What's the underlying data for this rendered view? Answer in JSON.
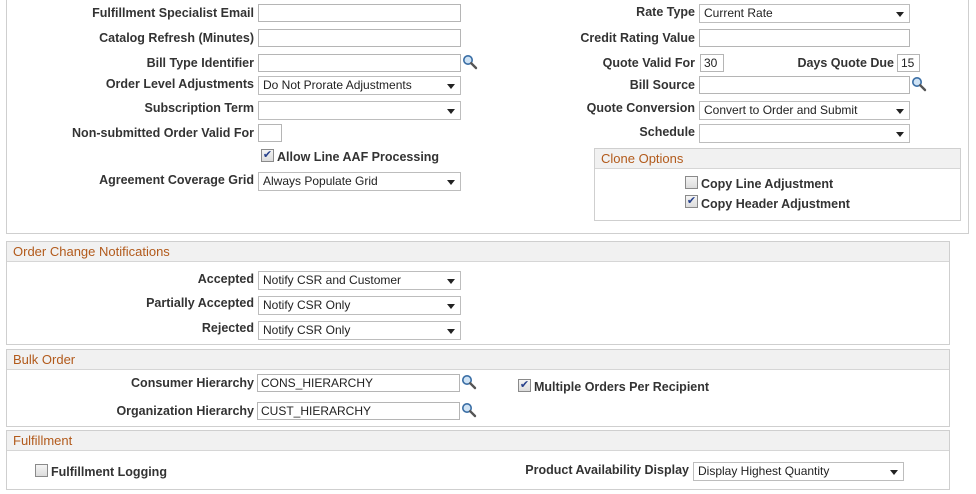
{
  "main": {
    "fulfillment_email": {
      "label": "Fulfillment Specialist Email",
      "value": ""
    },
    "catalog_refresh": {
      "label": "Catalog Refresh (Minutes)",
      "value": ""
    },
    "bill_type_identifier": {
      "label": "Bill Type Identifier",
      "value": ""
    },
    "order_level_adjustments": {
      "label": "Order Level Adjustments",
      "value": "Do Not Prorate Adjustments"
    },
    "subscription_term": {
      "label": "Subscription Term",
      "value": ""
    },
    "non_submitted_valid_for": {
      "label": "Non-submitted Order Valid For",
      "value": ""
    },
    "allow_line_aaf": {
      "label": "Allow Line AAF Processing",
      "checked": true
    },
    "agreement_coverage_grid": {
      "label": "Agreement Coverage Grid",
      "value": "Always Populate Grid"
    },
    "rate_type": {
      "label": "Rate Type",
      "value": "Current Rate"
    },
    "credit_rating_value": {
      "label": "Credit Rating Value",
      "value": ""
    },
    "quote_valid_for": {
      "label": "Quote Valid For",
      "value": "30"
    },
    "days_quote_due": {
      "label": "Days Quote Due",
      "value": "15"
    },
    "bill_source": {
      "label": "Bill Source",
      "value": ""
    },
    "quote_conversion": {
      "label": "Quote Conversion",
      "value": "Convert to Order and Submit"
    },
    "schedule": {
      "label": "Schedule",
      "value": ""
    }
  },
  "clone_options": {
    "title": "Clone Options",
    "copy_line_adjustment": {
      "label": "Copy Line Adjustment",
      "checked": false
    },
    "copy_header_adjustment": {
      "label": "Copy Header Adjustment",
      "checked": true
    }
  },
  "order_change": {
    "title": "Order Change Notifications",
    "accepted": {
      "label": "Accepted",
      "value": "Notify CSR and Customer"
    },
    "partially_accepted": {
      "label": "Partially Accepted",
      "value": "Notify CSR Only"
    },
    "rejected": {
      "label": "Rejected",
      "value": "Notify CSR Only"
    }
  },
  "bulk_order": {
    "title": "Bulk Order",
    "consumer_hierarchy": {
      "label": "Consumer Hierarchy",
      "value": "CONS_HIERARCHY"
    },
    "organization_hierarchy": {
      "label": "Organization Hierarchy",
      "value": "CUST_HIERARCHY"
    },
    "multiple_orders": {
      "label": "Multiple Orders Per Recipient",
      "checked": true
    }
  },
  "fulfillment": {
    "title": "Fulfillment",
    "fulfillment_logging": {
      "label": "Fulfillment Logging",
      "checked": false
    },
    "product_availability": {
      "label": "Product Availability Display",
      "value": "Display Highest Quantity"
    }
  },
  "colors": {
    "section_title": "#b25a1b",
    "border": "#cfcfcf",
    "header_bg": "#f1f1f1",
    "check": "#26408b"
  },
  "icons": {
    "lookup": "magnifier-lookup-icon",
    "dropdown": "chevron-down-icon",
    "check": "check-mark-icon"
  }
}
